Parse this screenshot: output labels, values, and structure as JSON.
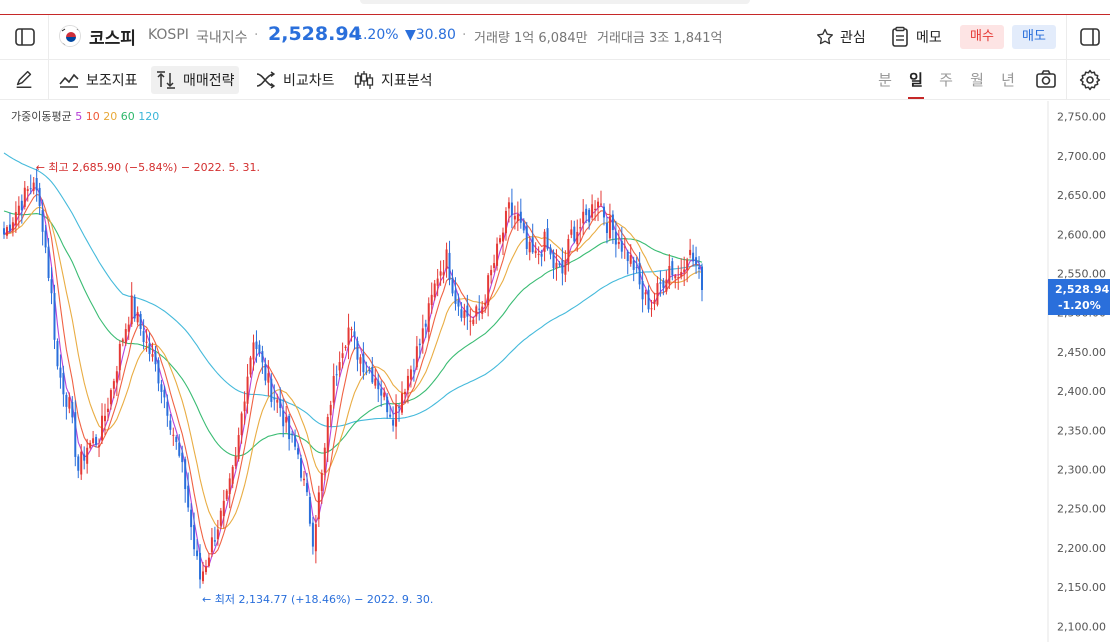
{
  "header": {
    "name": "코스피",
    "code": "KOSPI",
    "kind": "국내지수",
    "dot": "·",
    "price": "2,528.94",
    "change_pct": "-1.20%",
    "change_abs": "▼30.80",
    "volume": "거래량 1억 6,084만",
    "amount": "거래대금 3조 1,841억",
    "watch_label": "관심",
    "memo_label": "메모",
    "buy_label": "매수",
    "sell_label": "매도"
  },
  "toolbar": {
    "indicators_label": "보조지표",
    "strategy_label": "매매전략",
    "compare_label": "비교차트",
    "analysis_label": "지표분석",
    "periods": [
      "분",
      "일",
      "주",
      "월",
      "년"
    ],
    "active_period": "일"
  },
  "colors": {
    "up": "#e53935",
    "down": "#2a6fdb",
    "ma5": "#b53ad6",
    "ma10": "#ef5a3a",
    "ma20": "#e8a93a",
    "ma60": "#2fb86c",
    "ma120": "#3bb6d9"
  },
  "chart_data": {
    "type": "candlestick",
    "legend": {
      "title": "가중이동평균",
      "periods": [
        {
          "label": "5",
          "color": "#b53ad6"
        },
        {
          "label": "10",
          "color": "#ef5a3a"
        },
        {
          "label": "20",
          "color": "#e8a93a"
        },
        {
          "label": "60",
          "color": "#2fb86c"
        },
        {
          "label": "120",
          "color": "#3bb6d9"
        }
      ]
    },
    "ylim": [
      2080,
      2770
    ],
    "yticks": [
      "2,750.00",
      "2,700.00",
      "2,650.00",
      "2,600.00",
      "2,550.00",
      "2,500.00",
      "2,450.00",
      "2,400.00",
      "2,350.00",
      "2,300.00",
      "2,250.00",
      "2,200.00",
      "2,150.00",
      "2,100.00"
    ],
    "ytick_values": [
      2750,
      2700,
      2650,
      2600,
      2550,
      2500,
      2450,
      2400,
      2350,
      2300,
      2250,
      2200,
      2150,
      2100
    ],
    "last_price_label": "2,528.94",
    "last_change_label": "-1.20%",
    "last_price": 2528.94,
    "high_annotation": "← 최고 2,685.90 (−5.84%) − 2022. 5. 31.",
    "high_value": 2685.9,
    "high_index": 10,
    "low_annotation": "← 최저 2,134.77 (+18.46%) − 2022. 9. 30.",
    "low_value": 2134.77,
    "low_index": 66,
    "closes_anchors": [
      [
        0,
        2600
      ],
      [
        4,
        2630
      ],
      [
        8,
        2655
      ],
      [
        10,
        2665
      ],
      [
        13,
        2615
      ],
      [
        16,
        2520
      ],
      [
        18,
        2430
      ],
      [
        22,
        2380
      ],
      [
        25,
        2300
      ],
      [
        28,
        2330
      ],
      [
        32,
        2340
      ],
      [
        36,
        2400
      ],
      [
        40,
        2470
      ],
      [
        43,
        2510
      ],
      [
        46,
        2480
      ],
      [
        49,
        2450
      ],
      [
        52,
        2420
      ],
      [
        55,
        2380
      ],
      [
        58,
        2330
      ],
      [
        61,
        2280
      ],
      [
        64,
        2200
      ],
      [
        66,
        2160
      ],
      [
        69,
        2195
      ],
      [
        72,
        2230
      ],
      [
        75,
        2260
      ],
      [
        78,
        2310
      ],
      [
        81,
        2400
      ],
      [
        84,
        2470
      ],
      [
        87,
        2430
      ],
      [
        90,
        2400
      ],
      [
        93,
        2380
      ],
      [
        96,
        2340
      ],
      [
        99,
        2320
      ],
      [
        102,
        2260
      ],
      [
        104,
        2215
      ],
      [
        107,
        2290
      ],
      [
        110,
        2390
      ],
      [
        113,
        2450
      ],
      [
        116,
        2480
      ],
      [
        119,
        2450
      ],
      [
        122,
        2430
      ],
      [
        125,
        2420
      ],
      [
        128,
        2390
      ],
      [
        131,
        2370
      ],
      [
        134,
        2400
      ],
      [
        137,
        2430
      ],
      [
        140,
        2460
      ],
      [
        143,
        2500
      ],
      [
        146,
        2550
      ],
      [
        149,
        2570
      ],
      [
        152,
        2520
      ],
      [
        155,
        2500
      ],
      [
        158,
        2490
      ],
      [
        161,
        2510
      ],
      [
        164,
        2550
      ],
      [
        167,
        2590
      ],
      [
        170,
        2630
      ],
      [
        173,
        2620
      ],
      [
        176,
        2580
      ],
      [
        179,
        2570
      ],
      [
        182,
        2590
      ],
      [
        185,
        2560
      ],
      [
        188,
        2550
      ],
      [
        191,
        2600
      ],
      [
        194,
        2610
      ],
      [
        197,
        2625
      ],
      [
        200,
        2650
      ],
      [
        203,
        2615
      ],
      [
        206,
        2600
      ],
      [
        209,
        2580
      ],
      [
        212,
        2560
      ],
      [
        215,
        2520
      ],
      [
        218,
        2510
      ],
      [
        221,
        2535
      ],
      [
        224,
        2560
      ],
      [
        227,
        2545
      ],
      [
        230,
        2580
      ],
      [
        233,
        2560
      ],
      [
        235,
        2529
      ]
    ]
  }
}
